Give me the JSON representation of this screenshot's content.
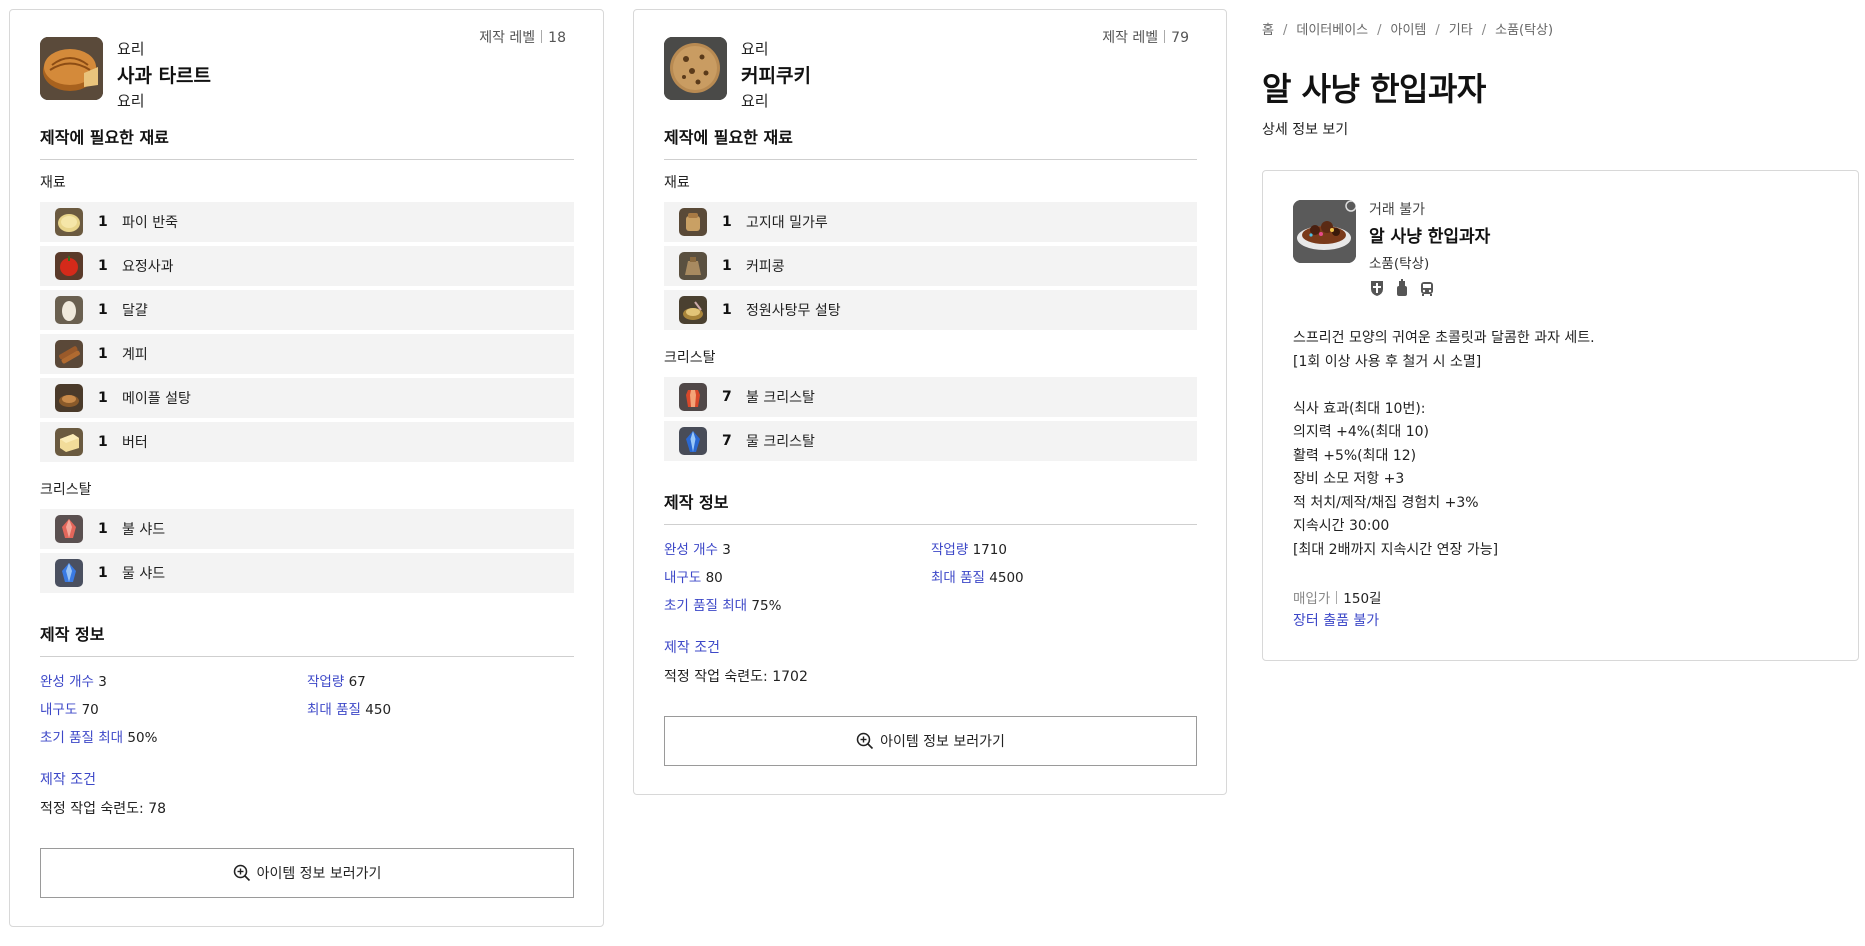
{
  "recipes": [
    {
      "category": "요리",
      "name": "사과 타르트",
      "category2": "요리",
      "level_label": "제작 레벨",
      "level": "18",
      "materials_title": "제작에 필요한 재료",
      "materials_label": "재료",
      "materials": [
        {
          "qty": "1",
          "name": "파이 반죽",
          "icon": "pie-dough-icon"
        },
        {
          "qty": "1",
          "name": "요정사과",
          "icon": "fairy-apple-icon"
        },
        {
          "qty": "1",
          "name": "달걀",
          "icon": "egg-icon"
        },
        {
          "qty": "1",
          "name": "계피",
          "icon": "cinnamon-icon"
        },
        {
          "qty": "1",
          "name": "메이플 설탕",
          "icon": "maple-sugar-icon"
        },
        {
          "qty": "1",
          "name": "버터",
          "icon": "butter-icon"
        }
      ],
      "crystals_label": "크리스탈",
      "crystals": [
        {
          "qty": "1",
          "name": "불 샤드",
          "icon": "fire-shard-icon"
        },
        {
          "qty": "1",
          "name": "물 샤드",
          "icon": "water-shard-icon"
        }
      ],
      "info_title": "제작 정보",
      "info": {
        "yield_label": "완성 개수",
        "yield": "3",
        "work_label": "작업량",
        "work": "67",
        "durability_label": "내구도",
        "durability": "70",
        "maxq_label": "최대 품질",
        "maxq": "450",
        "initq_label": "초기 품질 최대",
        "initq": "50%"
      },
      "condition_title": "제작 조건",
      "condition": "적정 작업 숙련도: 78",
      "button": "아이템 정보 보러가기"
    },
    {
      "category": "요리",
      "name": "커피쿠키",
      "category2": "요리",
      "level_label": "제작 레벨",
      "level": "79",
      "materials_title": "제작에 필요한 재료",
      "materials_label": "재료",
      "materials": [
        {
          "qty": "1",
          "name": "고지대 밀가루",
          "icon": "flour-icon"
        },
        {
          "qty": "1",
          "name": "커피콩",
          "icon": "coffee-bean-icon"
        },
        {
          "qty": "1",
          "name": "정원사탕무 설탕",
          "icon": "beet-sugar-icon"
        }
      ],
      "crystals_label": "크리스탈",
      "crystals": [
        {
          "qty": "7",
          "name": "불 크리스탈",
          "icon": "fire-crystal-icon"
        },
        {
          "qty": "7",
          "name": "물 크리스탈",
          "icon": "water-crystal-icon"
        }
      ],
      "info_title": "제작 정보",
      "info": {
        "yield_label": "완성 개수",
        "yield": "3",
        "work_label": "작업량",
        "work": "1710",
        "durability_label": "내구도",
        "durability": "80",
        "maxq_label": "최대 품질",
        "maxq": "4500",
        "initq_label": "초기 품질 최대",
        "initq": "75%"
      },
      "condition_title": "제작 조건",
      "condition": "적정 작업 숙련도: 1702",
      "button": "아이템 정보 보러가기"
    }
  ],
  "breadcrumb": [
    "홈",
    "데이터베이스",
    "아이템",
    "기타",
    "소품(탁상)"
  ],
  "page_title": "알 사냥 한입과자",
  "detail_link": "상세 정보 보기",
  "item": {
    "trade": "거래 불가",
    "name": "알 사냥 한입과자",
    "type": "소품(탁상)",
    "flags": [
      "armoire-icon",
      "dye-icon",
      "housing-icon"
    ],
    "description": [
      "스프리건 모양의 귀여운 초콜릿과 달콤한 과자 세트.",
      "[1회 이상 사용 후 철거 시 소멸]",
      "",
      "식사 효과(최대 10번):",
      "의지력 +4%(최대 10)",
      "활력 +5%(최대 12)",
      "장비 소모 저항 +3",
      "적 처치/제작/채집 경험치 +3%",
      "지속시간 30:00",
      "[최대 2배까지 지속시간 연장 가능]"
    ],
    "price_label": "매입가",
    "price": "150길",
    "market": "장터 출품 불가"
  }
}
